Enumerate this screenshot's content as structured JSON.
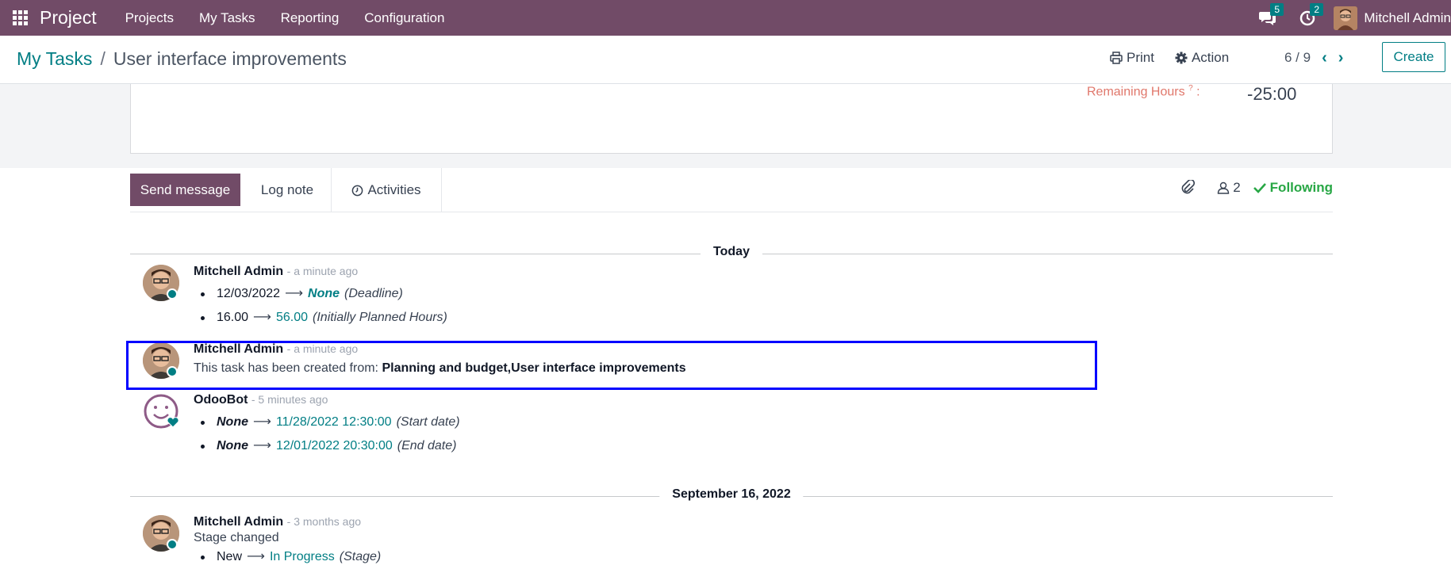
{
  "navbar": {
    "brand": "Project",
    "menu": [
      "Projects",
      "My Tasks",
      "Reporting",
      "Configuration"
    ],
    "messages_count": "5",
    "activities_count": "2",
    "user_name": "Mitchell Admin"
  },
  "control_panel": {
    "breadcrumb_parent": "My Tasks",
    "breadcrumb_separator": "/",
    "breadcrumb_current": "User interface improvements",
    "print_label": "Print",
    "action_label": "Action",
    "pager": "6 / 9",
    "create_label": "Create"
  },
  "form": {
    "remaining_hours_label": "Remaining Hours",
    "remaining_hours_help": "?",
    "remaining_hours_colon": ":",
    "remaining_hours_value": "-25:00"
  },
  "chatter": {
    "send_message_label": "Send message",
    "log_note_label": "Log note",
    "activities_label": "Activities",
    "followers_count": "2",
    "following_label": "Following",
    "date_sep_1": "Today",
    "date_sep_2": "September 16, 2022",
    "messages": [
      {
        "author": "Mitchell Admin",
        "date": "- a minute ago",
        "tracking": [
          {
            "old": "12/03/2022",
            "new": "None",
            "field": "(Deadline)"
          },
          {
            "old": "16.00",
            "new": "56.00",
            "field": "(Initially Planned Hours)"
          }
        ]
      },
      {
        "author": "Mitchell Admin",
        "date": "- a minute ago",
        "text_prefix": "This task has been created from: ",
        "text_bold": "Planning and budget,User interface improvements"
      },
      {
        "author": "OdooBot",
        "date": "- 5 minutes ago",
        "tracking": [
          {
            "old": "None",
            "new": "11/28/2022 12:30:00",
            "field": "(Start date)"
          },
          {
            "old": "None",
            "new": "12/01/2022 20:30:00",
            "field": "(End date)"
          }
        ]
      },
      {
        "author": "Mitchell Admin",
        "date": "- 3 months ago",
        "text": "Stage changed",
        "tracking": [
          {
            "old": "New",
            "new": "In Progress",
            "field": "(Stage)"
          }
        ]
      }
    ]
  },
  "colors": {
    "brand_purple": "#714b67",
    "teal": "#017e84",
    "following_green": "#28a745",
    "highlight_blue": "#0000ff"
  }
}
